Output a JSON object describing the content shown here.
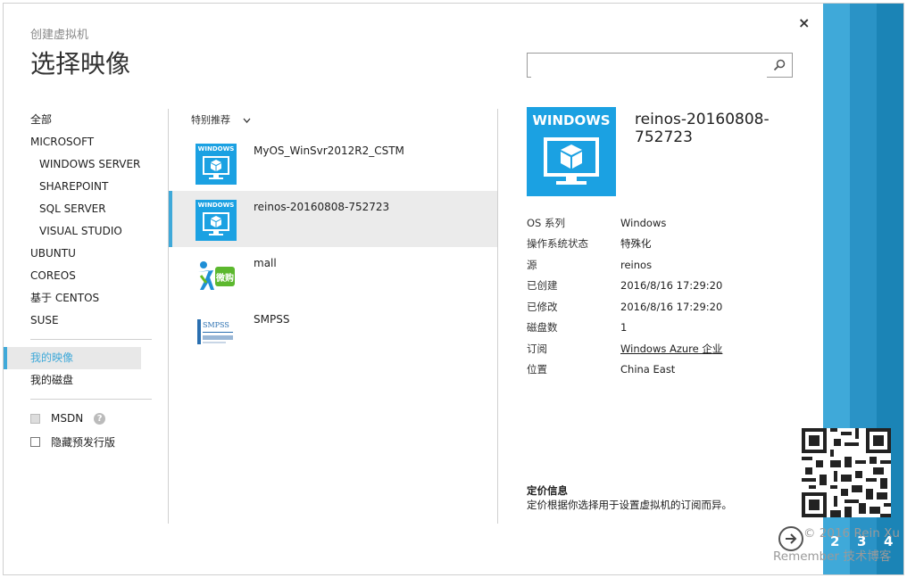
{
  "window": {
    "subtitle": "创建虚拟机",
    "title": "选择映像",
    "close_glyph": "×"
  },
  "search": {
    "placeholder": "",
    "value": ""
  },
  "nav": {
    "items": [
      {
        "label": "全部"
      },
      {
        "label": "MICROSOFT"
      },
      {
        "label": "WINDOWS SERVER"
      },
      {
        "label": "SHAREPOINT"
      },
      {
        "label": "SQL SERVER"
      },
      {
        "label": "VISUAL STUDIO"
      },
      {
        "label": "UBUNTU"
      },
      {
        "label": "COREOS"
      },
      {
        "label": "基于 CENTOS"
      },
      {
        "label": "SUSE"
      }
    ],
    "my_images": "我的映像",
    "my_disks": "我的磁盘",
    "msdn_label": "MSDN",
    "hide_preview_label": "隐藏预发行版"
  },
  "filter": {
    "label": "特别推荐"
  },
  "list": {
    "items": [
      {
        "name": "MyOS_WinSvr2012R2_CSTM",
        "logo_text": "WINDOWS"
      },
      {
        "name": "reinos-20160808-752723",
        "logo_text": "WINDOWS"
      },
      {
        "name": "mall",
        "logo_text": "微购"
      },
      {
        "name": "SMPSS",
        "logo_text": "SMPSS"
      }
    ]
  },
  "detail": {
    "logo_text": "WINDOWS",
    "name": "reinos-20160808-752723",
    "props": [
      {
        "k": "OS 系列",
        "v": "Windows"
      },
      {
        "k": "操作系统状态",
        "v": "特殊化"
      },
      {
        "k": "源",
        "v": "reinos"
      },
      {
        "k": "已创建",
        "v": "2016/8/16 17:29:20"
      },
      {
        "k": "已修改",
        "v": "2016/8/16 17:29:20"
      },
      {
        "k": "磁盘数",
        "v": "1"
      },
      {
        "k": "订阅",
        "v": "Windows Azure 企业"
      },
      {
        "k": "位置",
        "v": "China East"
      }
    ],
    "pricing_heading": "定价信息",
    "pricing_text": "定价根据你选择用于设置虚拟机的订阅而异。"
  },
  "steps": [
    "2",
    "3",
    "4"
  ],
  "watermark": {
    "line1": "© 2016 Rein Xu",
    "line2": "Remember 技术博客"
  },
  "colors": {
    "accent": "#3fa9d9",
    "logo_blue": "#1ba1e2"
  }
}
